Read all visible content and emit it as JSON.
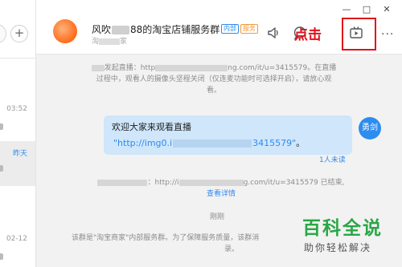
{
  "sidebar": {
    "items": [
      {
        "time": "03:52"
      },
      {
        "time": "昨天"
      },
      {
        "time": "02-12"
      }
    ],
    "plus_glyph": "+"
  },
  "header": {
    "group_name_prefix": "风吹",
    "group_name_suffix": "88的淘宝店铺服务群",
    "badge_internal": "内部",
    "badge_service": "服务",
    "sub_name_prefix": "淘",
    "sub_name_suffix": "家",
    "click_label": "点击",
    "more_glyph": "···",
    "window_controls": {
      "minimize": "—",
      "maximize": "□",
      "close": "✕"
    },
    "icons": [
      "speaker-icon",
      "chat-bubble-icon",
      "live-video-icon",
      "more-icon"
    ]
  },
  "chat": {
    "system_message_1": {
      "line1_suffix": "发起直播：http",
      "line1_mid": "ng.com/it/u=3415579。在直播",
      "line2": "过程中，观看人的摄像头坚程关闭（仅连麦功能时可选择开启），请放心观",
      "line3": "看。"
    },
    "bubble": {
      "line1": "欢迎大家来观看直播",
      "link_prefix": "\"http://img0.i",
      "link_suffix": "3415579\"",
      "period": "。"
    },
    "my_avatar_text": "勇剑",
    "read_status": "1人未读",
    "system_message_2": {
      "prefix": "：http://i",
      "suffix": "g.com/it/u=3415579 已结束,"
    },
    "view_details": "查看详情",
    "just_now": "刚刚",
    "system_message_3": {
      "line1": "该群是\"淘宝商家\"内部服务群。为了保障服务质量，该群消",
      "line2": "录。"
    }
  },
  "watermark": {
    "title": "百科全说",
    "subtitle": "助你轻松解决"
  },
  "colors": {
    "accent": "#2d8cf0",
    "highlight": "#e0101a",
    "chat_bg": "#f2f2f2",
    "bubble_bg": "#cfe6fb",
    "watermark": "#29a745"
  }
}
